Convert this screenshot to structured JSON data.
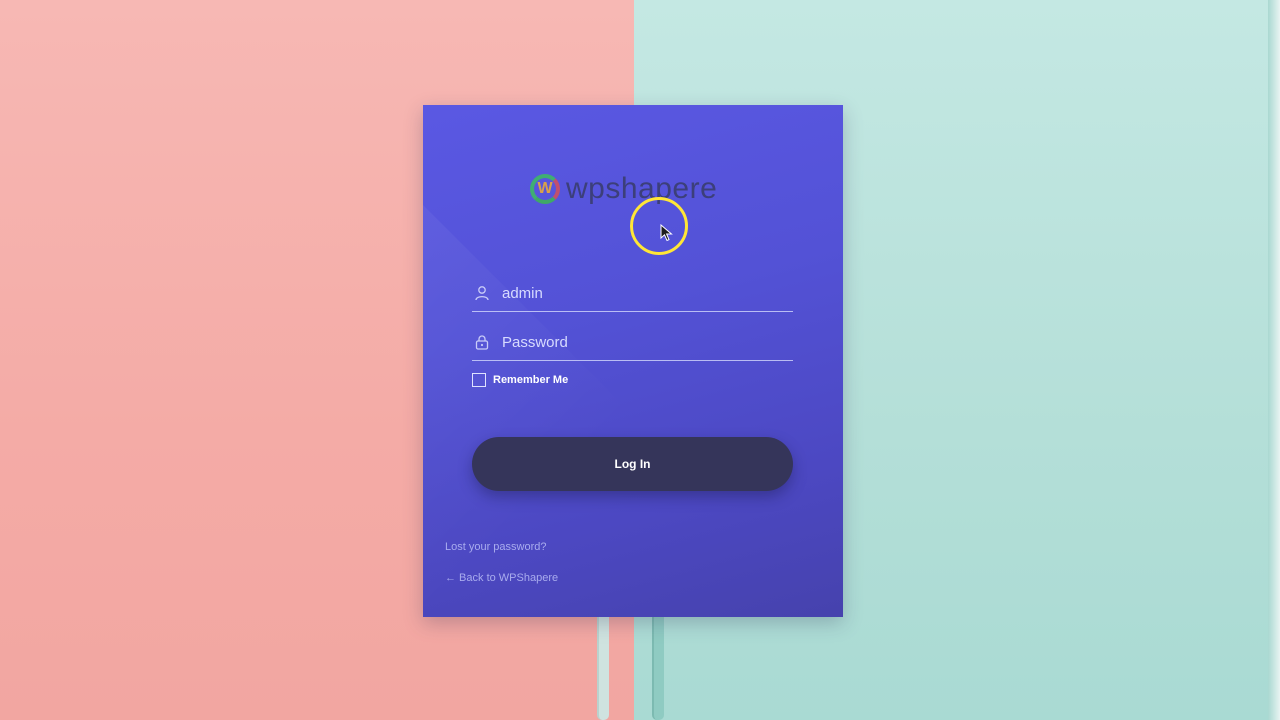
{
  "brand": {
    "logo_text": "wpshapere",
    "logo_mark": "W"
  },
  "login_form": {
    "username": {
      "placeholder": "admin",
      "icon": "user-icon"
    },
    "password": {
      "placeholder": "Password",
      "icon": "lock-icon"
    },
    "remember_label": "Remember Me",
    "remember_checked": false,
    "submit_label": "Log In"
  },
  "links": {
    "lost_password": "Lost your password?",
    "back_to_site": "← Back to WPShapere"
  },
  "colors": {
    "card_top": "#5a58e3",
    "card_bottom": "#4642ad",
    "button": "#35355a",
    "background_left": "#f4aba6",
    "background_right": "#b4dfd8"
  }
}
